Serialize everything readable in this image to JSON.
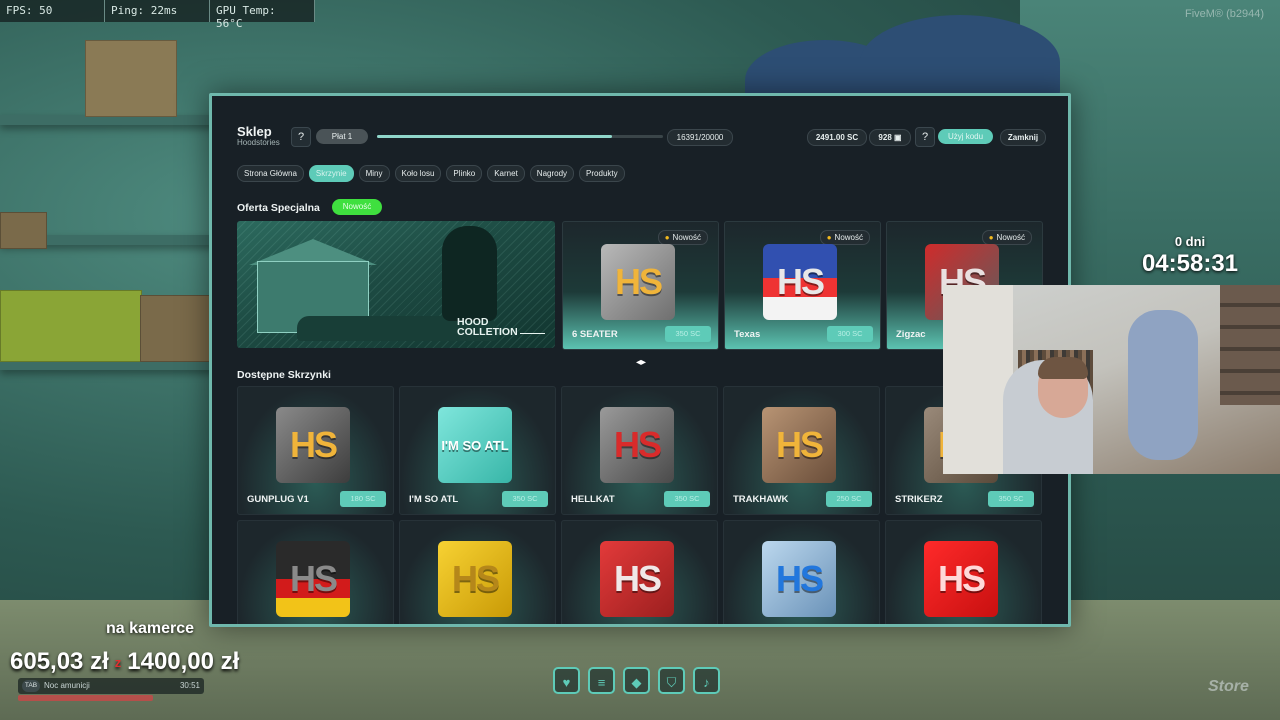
{
  "hud": {
    "fps": "FPS: 50",
    "ping": "Ping: 22ms",
    "gpu": "GPU Temp: 56°C",
    "build": "FiveM® (b2944)"
  },
  "shop": {
    "title": "Sklep",
    "subtitle": "Hoodstories",
    "help": "?",
    "level": "Płat 1",
    "xp_text": "16391/20000",
    "xp_progress": 0.82,
    "money": "2491.00 SC",
    "coins": "928",
    "use_code": "Użyj kodu",
    "close": "Zamknij",
    "tabs": [
      {
        "label": "Strona Główna",
        "active": false
      },
      {
        "label": "Skrzynie",
        "active": true
      },
      {
        "label": "Miny",
        "active": false
      },
      {
        "label": "Koło losu",
        "active": false
      },
      {
        "label": "Plinko",
        "active": false
      },
      {
        "label": "Karnet",
        "active": false
      },
      {
        "label": "Nagrody",
        "active": false
      },
      {
        "label": "Produkty",
        "active": false
      }
    ],
    "special": {
      "title": "Oferta Specjalna",
      "badge": "Nowość",
      "hero_line1": "HOOD",
      "hero_line2": "COLLETION",
      "cards": [
        {
          "name": "6 SEATER",
          "price": "350 SC",
          "tag": "Nowość",
          "cube_label": "HS"
        },
        {
          "name": "Texas",
          "price": "300 SC",
          "tag": "Nowość",
          "cube_label": "HS"
        },
        {
          "name": "Zigzac",
          "price": "",
          "tag": "Nowość",
          "cube_label": "HS"
        }
      ]
    },
    "available": {
      "title": "Dostępne Skrzynki",
      "row1": [
        {
          "name": "GUNPLUG V1",
          "price": "180 SC",
          "cube_label": "HS"
        },
        {
          "name": "I'M SO ATL",
          "price": "350 SC",
          "cube_label": "I'M SO ATL"
        },
        {
          "name": "HELLKAT",
          "price": "350 SC",
          "cube_label": "HS"
        },
        {
          "name": "TRAKHAWK",
          "price": "250 SC",
          "cube_label": "HS"
        },
        {
          "name": "STRIKERZ",
          "price": "350 SC",
          "cube_label": "HS"
        }
      ],
      "row2": [
        {
          "cube_label": "HS"
        },
        {
          "cube_label": "HS"
        },
        {
          "cube_label": "HS"
        },
        {
          "cube_label": "HS"
        },
        {
          "cube_label": "HS"
        }
      ]
    }
  },
  "stream": {
    "days": "0 dni",
    "time": "04:58:31",
    "camera_label": "na kamerce",
    "goal_current": "605,03 zł",
    "goal_sep": "z",
    "goal_target": "1400,00 zł",
    "ammo_key": "TAB",
    "ammo_text": "Noc amunicji",
    "ammo_time": "30:51",
    "logo": "Store"
  },
  "colors": {
    "accent": "#5ecbb8",
    "new_badge": "#3fe03f",
    "panel_bg": "#182026",
    "cube_gold": "#f0b43a"
  },
  "icons": [
    "heart-icon",
    "burger-icon",
    "water-drop-icon",
    "shield-icon",
    "microphone-icon"
  ]
}
